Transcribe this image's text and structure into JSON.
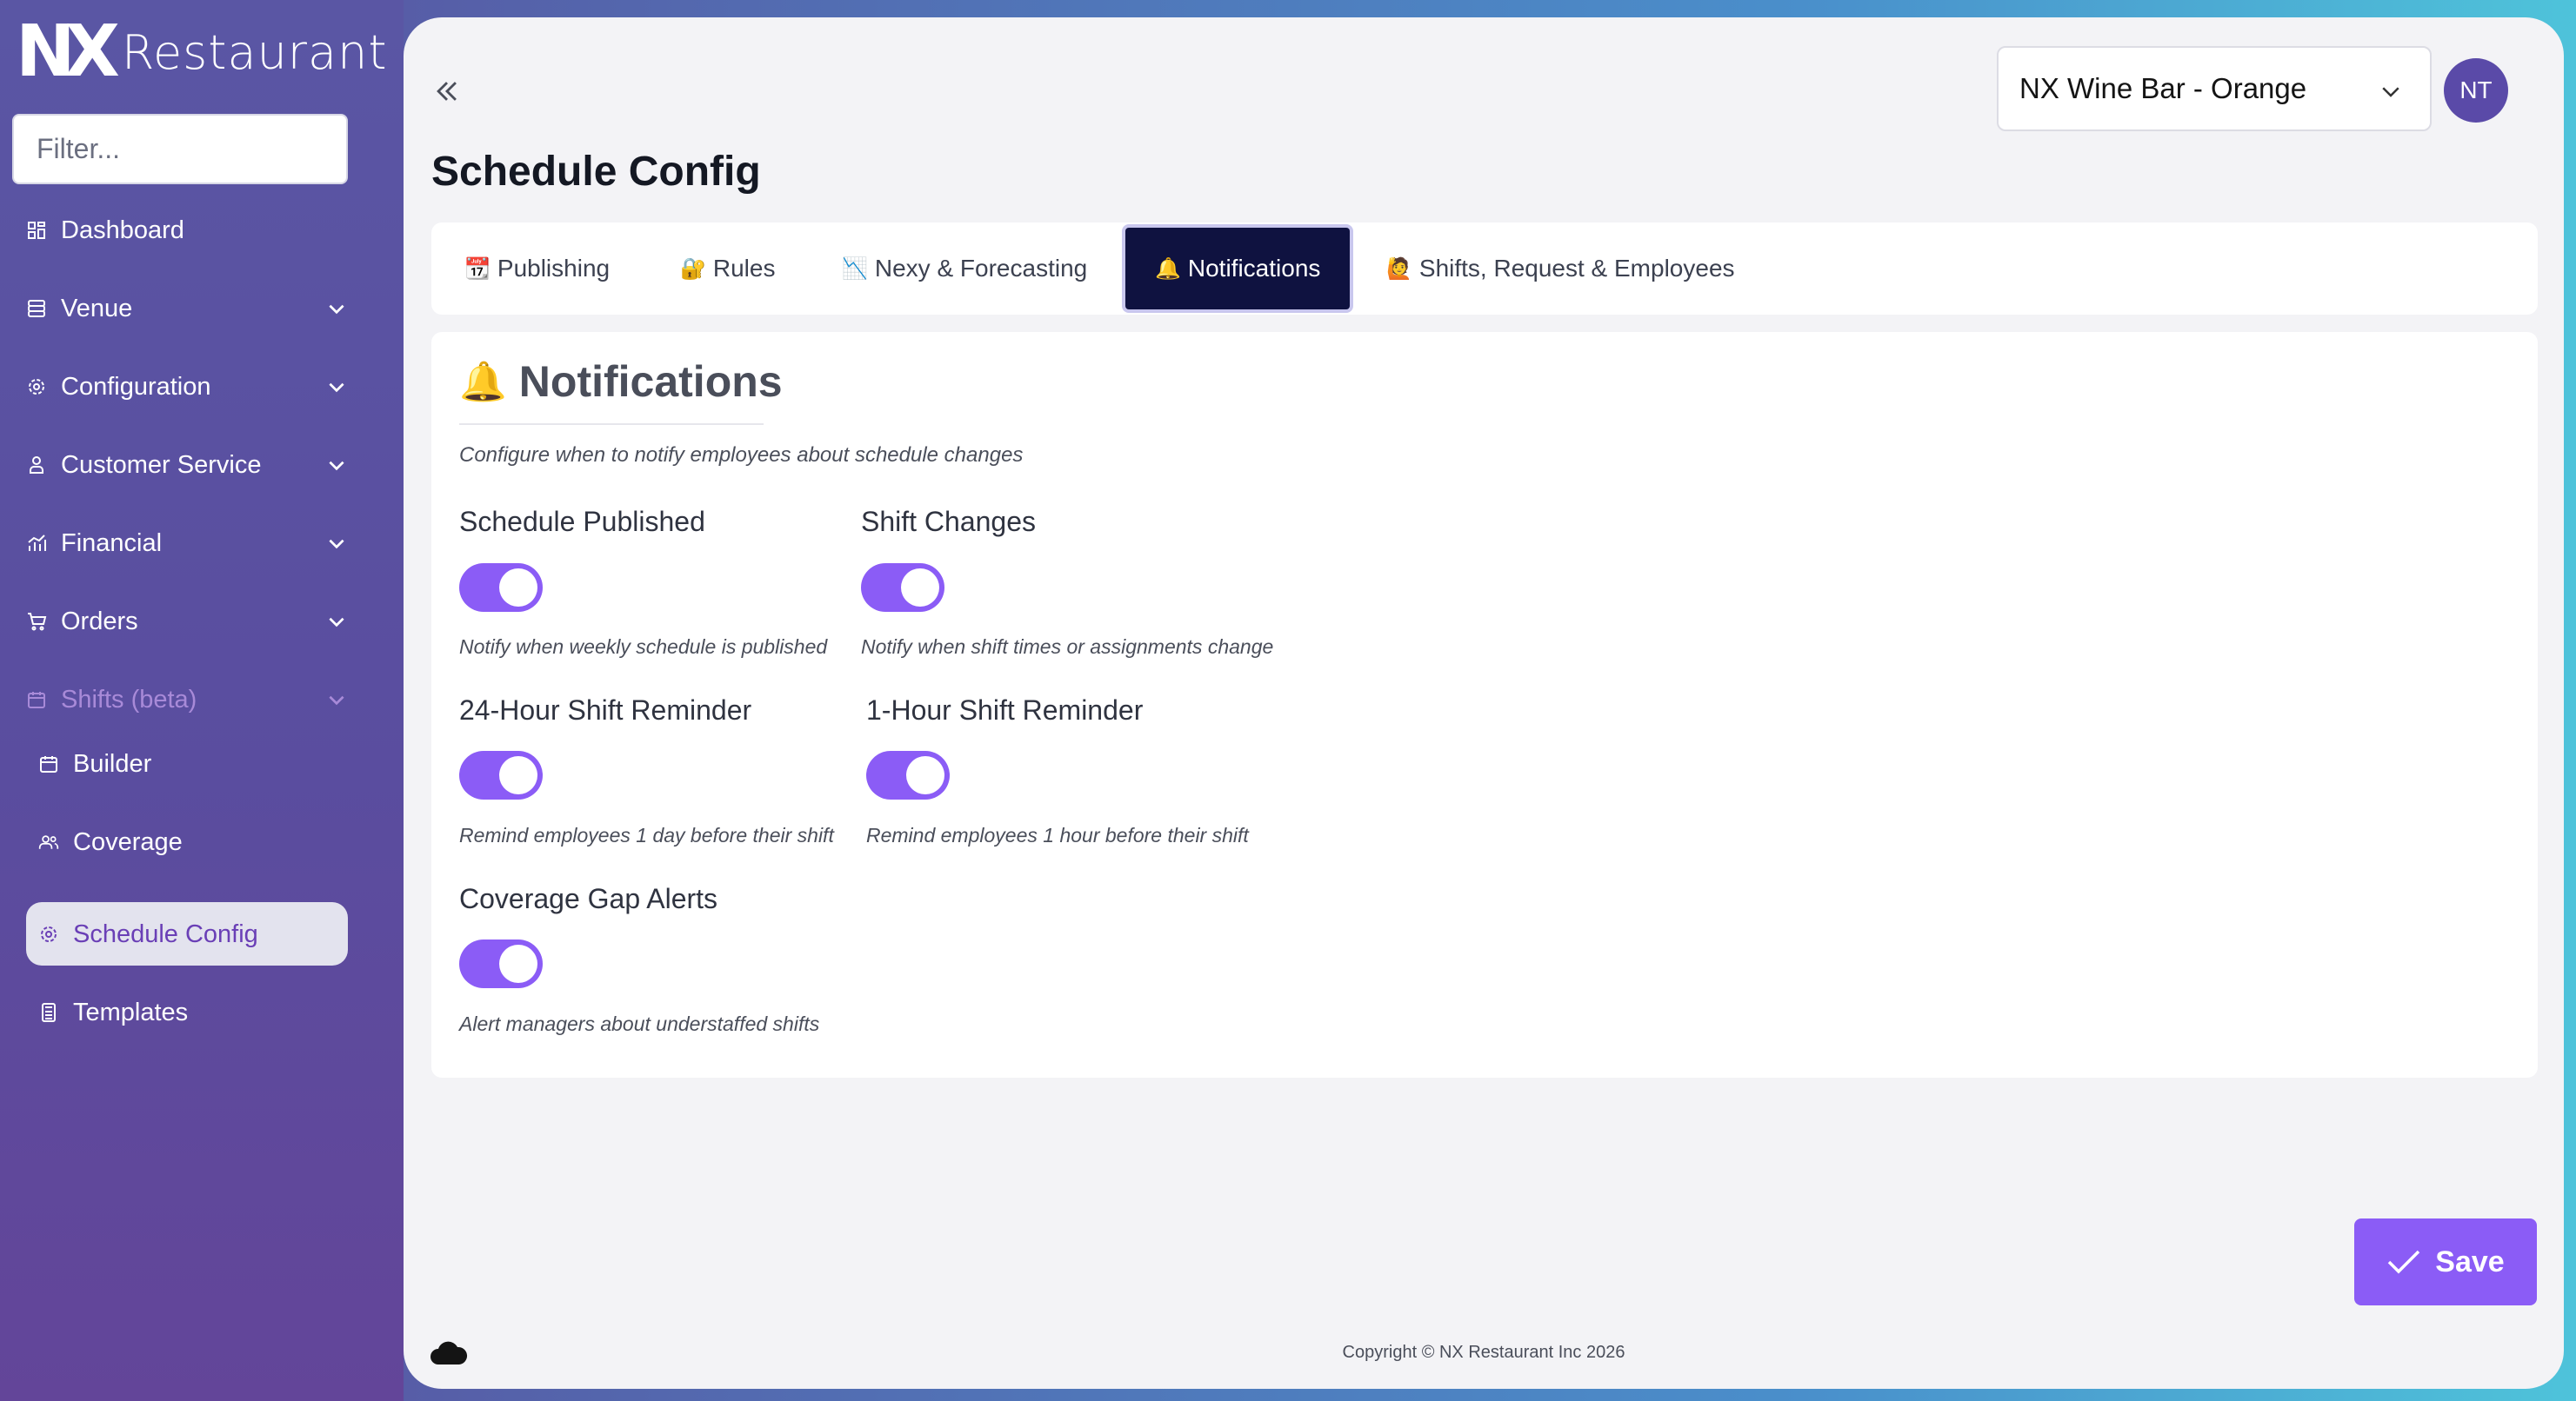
{
  "brand": {
    "logo": "NX",
    "name": "Restaurant"
  },
  "sidebar": {
    "filter_placeholder": "Filter...",
    "items": [
      {
        "label": "Dashboard",
        "icon": "dashboard-grid-icon"
      },
      {
        "label": "Venue",
        "icon": "database-icon"
      },
      {
        "label": "Configuration",
        "icon": "gear-icon"
      },
      {
        "label": "Customer Service",
        "icon": "user-support-icon"
      },
      {
        "label": "Financial",
        "icon": "chart-icon"
      },
      {
        "label": "Orders",
        "icon": "cart-icon"
      },
      {
        "label": "Shifts (beta)",
        "icon": "calendar-icon"
      }
    ],
    "shift_sub_items": [
      {
        "label": "Builder",
        "icon": "calendar-icon"
      },
      {
        "label": "Coverage",
        "icon": "users-icon"
      },
      {
        "label": "Schedule Config",
        "icon": "gear-icon",
        "active": true
      },
      {
        "label": "Templates",
        "icon": "calculator-icon"
      }
    ]
  },
  "header": {
    "venue": "NX Wine Bar - Orange",
    "avatar_initials": "NT"
  },
  "page_title": "Schedule Config",
  "tabs": [
    {
      "label": "Publishing",
      "emoji": "📆"
    },
    {
      "label": "Rules",
      "emoji": "🔐"
    },
    {
      "label": "Nexy & Forecasting",
      "emoji": "📉"
    },
    {
      "label": "Notifications",
      "emoji": "🔔",
      "active": true
    },
    {
      "label": "Shifts, Request & Employees",
      "emoji": "🙋"
    }
  ],
  "section": {
    "emoji": "🔔",
    "title": "Notifications",
    "description": "Configure when to notify employees about schedule changes",
    "settings": [
      {
        "label": "Schedule Published",
        "enabled": true,
        "description": "Notify when weekly schedule is published"
      },
      {
        "label": "Shift Changes",
        "enabled": true,
        "description": "Notify when shift times or assignments change"
      },
      {
        "label": "24-Hour Shift Reminder",
        "enabled": true,
        "description": "Remind employees 1 day before their shift"
      },
      {
        "label": "1-Hour Shift Reminder",
        "enabled": true,
        "description": "Remind employees 1 hour before their shift"
      },
      {
        "label": "Coverage Gap Alerts",
        "enabled": true,
        "description": "Alert managers about understaffed shifts"
      }
    ]
  },
  "save_label": "Save",
  "footer": "Copyright © NX Restaurant Inc 2026",
  "colors": {
    "accent": "#8b5cf6",
    "active_tab": "#0f1240",
    "sidebar": "#5a56a4",
    "active_nav_text": "#6a3fb6"
  }
}
